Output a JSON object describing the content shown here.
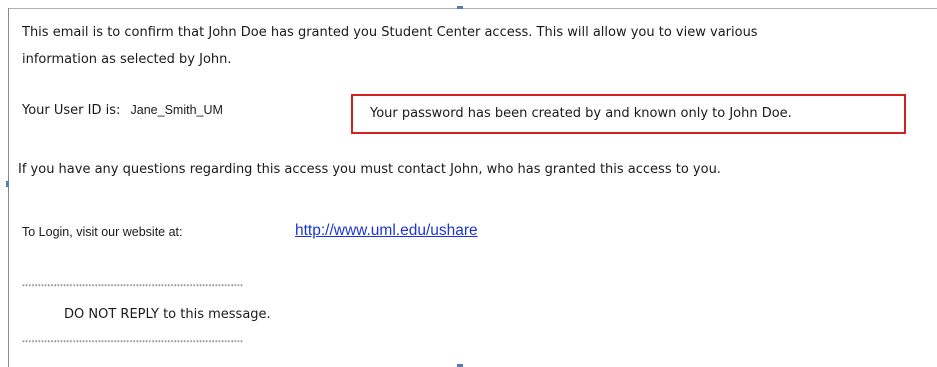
{
  "email": {
    "intro_line_1": "This email is to confirm that John Doe has granted you Student Center access.  This will allow you to view various",
    "intro_line_2": "information as selected by John.",
    "user_id_label": "Your User ID is:",
    "user_id_value": "Jane_Smith_UM",
    "password_notice": "Your password has been created by and known only to John Doe.",
    "contact_line": "If you have any questions regarding this access you must contact John, who has granted this access to you.",
    "login_label": "To Login, visit our website at:",
    "login_url": "http://www.uml.edu/ushare",
    "stars_top": "**********************************************************************",
    "no_reply": "DO NOT REPLY to this message.",
    "stars_bottom": "**********************************************************************"
  },
  "colors": {
    "highlight_border": "#d12020",
    "link": "#1a35d6"
  }
}
